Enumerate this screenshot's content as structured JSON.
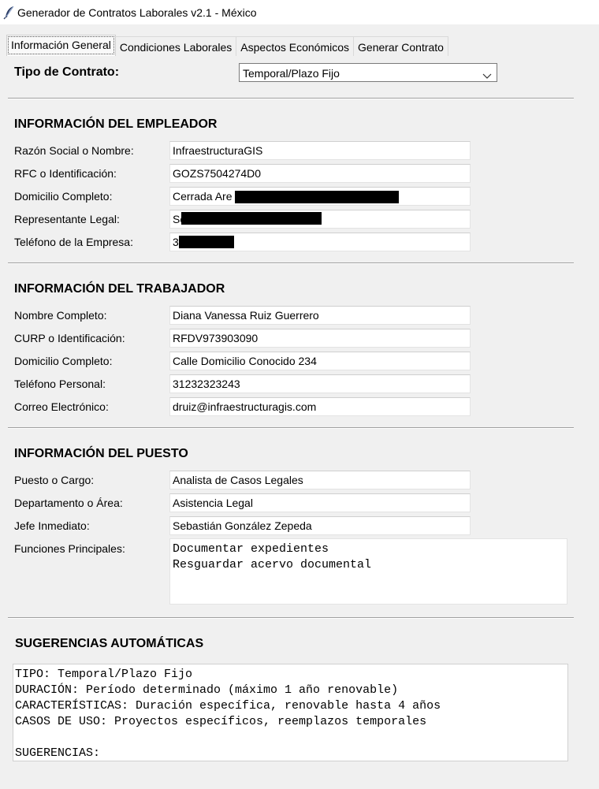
{
  "window": {
    "title": "Generador de Contratos Laborales v2.1 - México",
    "icon": "feather-icon"
  },
  "tabs": [
    "Información General",
    "Condiciones Laborales",
    "Aspectos Económicos",
    "Generar Contrato"
  ],
  "contract": {
    "label": "Tipo de Contrato:",
    "value": "Temporal/Plazo Fijo"
  },
  "employer": {
    "heading": "INFORMACIÓN DEL EMPLEADOR",
    "fields": [
      {
        "label": "Razón Social o Nombre:",
        "value": "InfraestructuraGIS"
      },
      {
        "label": "RFC o Identificación:",
        "value": "GOZS7504274D0"
      },
      {
        "label": "Domicilio Completo:",
        "value": "Cerrada Are"
      },
      {
        "label": "Representante Legal:",
        "value": "Se"
      },
      {
        "label": "Teléfono de la Empresa:",
        "value": "3"
      }
    ]
  },
  "worker": {
    "heading": "INFORMACIÓN DEL TRABAJADOR",
    "fields": [
      {
        "label": "Nombre Completo:",
        "value": "Diana Vanessa Ruiz Guerrero"
      },
      {
        "label": "CURP o Identificación:",
        "value": "RFDV973903090"
      },
      {
        "label": "Domicilio Completo:",
        "value": "Calle Domicilio Conocido 234"
      },
      {
        "label": "Teléfono Personal:",
        "value": "31232323243"
      },
      {
        "label": "Correo Electrónico:",
        "value": "druiz@infraestructuragis.com"
      }
    ]
  },
  "position": {
    "heading": "INFORMACIÓN DEL PUESTO",
    "fields": [
      {
        "label": "Puesto o Cargo:",
        "value": "Analista de Casos Legales"
      },
      {
        "label": "Departamento o Área:",
        "value": "Asistencia Legal"
      },
      {
        "label": "Jefe Inmediato:",
        "value": "Sebastián González Zepeda"
      }
    ],
    "functions_label": "Funciones Principales:",
    "functions_text": "Documentar expedientes\nResguardar acervo documental"
  },
  "suggestions": {
    "heading": "SUGERENCIAS AUTOMÁTICAS",
    "text": "TIPO: Temporal/Plazo Fijo\nDURACIÓN: Período determinado (máximo 1 año renovable)\nCARACTERÍSTICAS: Duración específica, renovable hasta 4 años\nCASOS DE USO: Proyectos específicos, reemplazos temporales\n\nSUGERENCIAS:"
  }
}
